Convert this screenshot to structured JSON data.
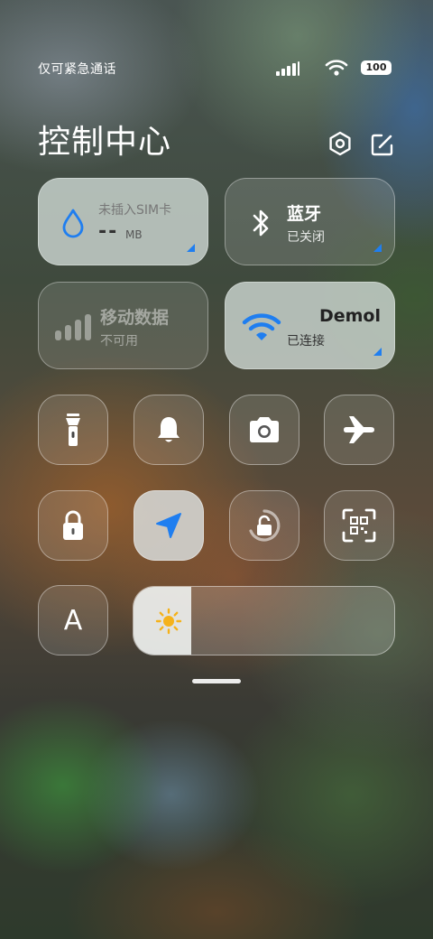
{
  "status_bar": {
    "carrier_text": "仅可紧急通话",
    "battery": "100"
  },
  "header": {
    "title": "控制中心",
    "settings_icon": "hexagon-settings-icon",
    "edit_icon": "edit-icon"
  },
  "tiles": {
    "data_usage": {
      "label": "未插入SIM卡",
      "value": "--",
      "unit": "MB"
    },
    "bluetooth": {
      "title": "蓝牙",
      "status": "已关闭"
    },
    "mobile_data": {
      "title": "移动数据",
      "status": "不可用"
    },
    "wifi": {
      "title": "Demol",
      "status": "已连接"
    }
  },
  "toggles_row1": [
    "flashlight-icon",
    "bell-icon",
    "camera-icon",
    "airplane-icon"
  ],
  "toggles_row2": [
    "lock-icon",
    "location-icon",
    "rotation-lock-icon",
    "qr-scan-icon"
  ],
  "font_toggle": {
    "label": "A"
  },
  "brightness": {
    "level": 0.22
  },
  "colors": {
    "accent": "#1f7ef0",
    "sun": "#f5b21a"
  }
}
